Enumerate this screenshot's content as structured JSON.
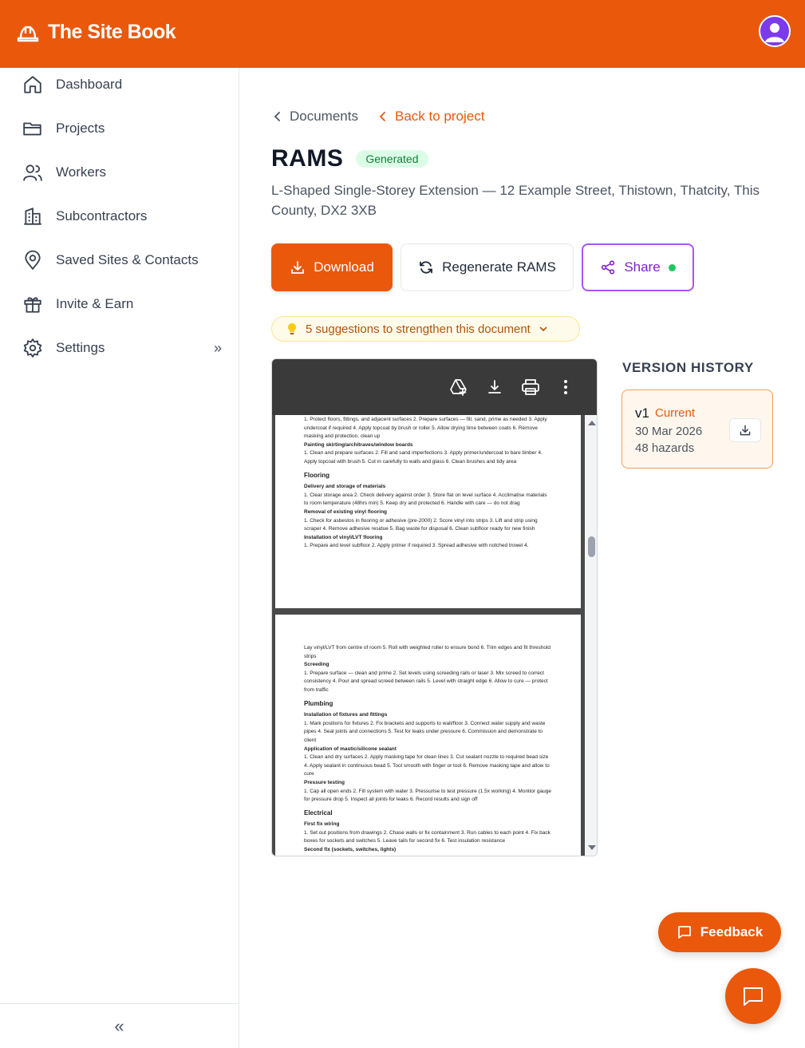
{
  "header": {
    "brand": "The Site Book",
    "brand_icon": "hard-hat-icon",
    "avatar_icon": "user-icon"
  },
  "sidebar": {
    "items": [
      {
        "label": "Dashboard",
        "icon": "home-icon"
      },
      {
        "label": "Projects",
        "icon": "folder-icon"
      },
      {
        "label": "Workers",
        "icon": "users-icon"
      },
      {
        "label": "Subcontractors",
        "icon": "building-icon"
      },
      {
        "label": "Saved Sites & Contacts",
        "icon": "map-pin-icon"
      },
      {
        "label": "Invite & Earn",
        "icon": "gift-icon"
      },
      {
        "label": "Settings",
        "icon": "gear-icon",
        "expand": "»"
      }
    ],
    "collapse": "«"
  },
  "breadcrumb": {
    "documents": "Documents",
    "back": "Back to project"
  },
  "page": {
    "title": "RAMS",
    "status": "Generated",
    "subtitle": "L-Shaped Single-Storey Extension — 12 Example Street, Thistown, Thatcity, This County, DX2 3XB"
  },
  "actions": {
    "download": "Download",
    "regenerate": "Regenerate RAMS",
    "share": "Share"
  },
  "suggestions": {
    "text": "5 suggestions to strengthen this document",
    "icon": "lightbulb-icon"
  },
  "pdf": {
    "page1": [
      {
        "t": "p",
        "v": "1. Protect floors, fittings, and adjacent surfaces 2. Prepare surfaces — fill, sand, prime as needed 3. Apply undercoat if required 4. Apply topcoat by brush or roller 5. Allow drying time between coats 6. Remove masking and protection, clean up"
      },
      {
        "t": "s",
        "v": "Painting skirting/architraves/window boards"
      },
      {
        "t": "p",
        "v": "1. Clean and prepare surfaces 2. Fill and sand imperfections 3. Apply primer/undercoat to bare timber 4. Apply topcoat with brush 5. Cut in carefully to walls and glass 6. Clean brushes and tidy area"
      },
      {
        "t": "h",
        "v": "Flooring"
      },
      {
        "t": "s",
        "v": "Delivery and storage of materials"
      },
      {
        "t": "p",
        "v": "1. Clear storage area 2. Check delivery against order 3. Store flat on level surface 4. Acclimatise materials to room temperature (48hrs min) 5. Keep dry and protected 6. Handle with care — do not drag"
      },
      {
        "t": "s",
        "v": "Removal of existing vinyl flooring"
      },
      {
        "t": "p",
        "v": "1. Check for asbestos in flooring or adhesive (pre-2000) 2. Score vinyl into strips 3. Lift and strip using scraper 4. Remove adhesive residue 5. Bag waste for disposal 6. Clean subfloor ready for new finish"
      },
      {
        "t": "s",
        "v": "Installation of vinyl/LVT flooring"
      },
      {
        "t": "p",
        "v": "1. Prepare and level subfloor 2. Apply primer if required 3. Spread adhesive with notched trowel 4."
      }
    ],
    "page2": [
      {
        "t": "p",
        "v": "Lay vinyl/LVT from centre of room 5. Roll with weighted roller to ensure bond 6. Trim edges and fit threshold strips"
      },
      {
        "t": "s",
        "v": "Screeding"
      },
      {
        "t": "p",
        "v": "1. Prepare surface — clean and prime 2. Set levels using screeding rails or laser 3. Mix screed to correct consistency 4. Pour and spread screed between rails 5. Level with straight edge 6. Allow to cure — protect from traffic"
      },
      {
        "t": "h",
        "v": "Plumbing"
      },
      {
        "t": "s",
        "v": "Installation of fixtures and fittings"
      },
      {
        "t": "p",
        "v": "1. Mark positions for fixtures 2. Fix brackets and supports to wall/floor 3. Connect water supply and waste pipes 4. Seal joints and connections 5. Test for leaks under pressure 6. Commission and demonstrate to client"
      },
      {
        "t": "s",
        "v": "Application of mastic/silicone sealant"
      },
      {
        "t": "p",
        "v": "1. Clean and dry surfaces 2. Apply masking tape for clean lines 3. Cut sealant nozzle to required bead size 4. Apply sealant in continuous bead 5. Tool smooth with finger or tool 6. Remove masking tape and allow to cure"
      },
      {
        "t": "s",
        "v": "Pressure testing"
      },
      {
        "t": "p",
        "v": "1. Cap all open ends 2. Fill system with water 3. Pressurise to test pressure (1.5x working) 4. Monitor gauge for pressure drop 5. Inspect all joints for leaks 6. Record results and sign off"
      },
      {
        "t": "h",
        "v": "Electrical"
      },
      {
        "t": "s",
        "v": "First fix wiring"
      },
      {
        "t": "p",
        "v": "1. Set out positions from drawings 2. Chase walls or fix containment 3. Run cables to each point 4. Fix back boxes for sockets and switches 5. Leave tails for second fix 6. Test insulation resistance"
      },
      {
        "t": "s",
        "v": "Second fix (sockets, switches, lights)"
      }
    ]
  },
  "version_history": {
    "title": "VERSION HISTORY",
    "versions": [
      {
        "version": "v1",
        "tag": "Current",
        "date": "30 Mar 2026",
        "hazards": "48 hazards"
      }
    ]
  },
  "feedback": {
    "label": "Feedback"
  },
  "colors": {
    "accent": "#ea580c",
    "success": "#22c55e",
    "share": "#a855f7"
  }
}
